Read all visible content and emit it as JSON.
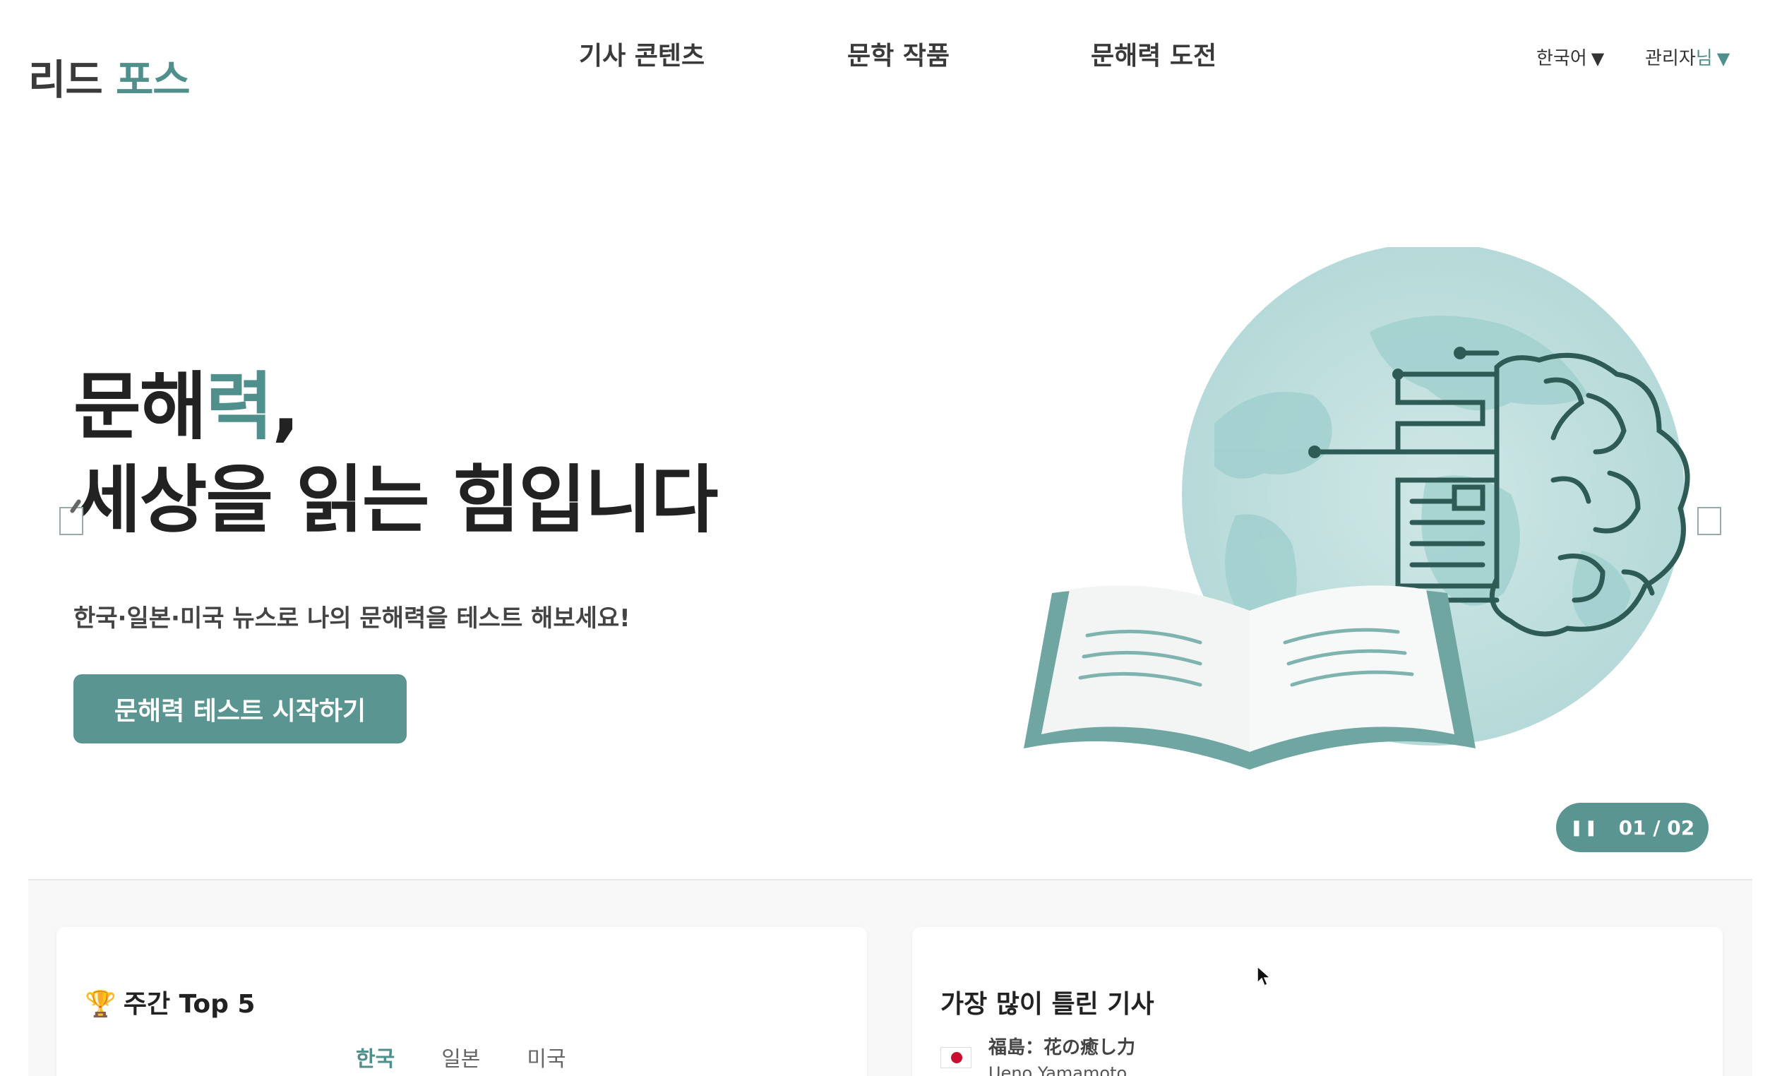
{
  "header": {
    "logo_main": "리드",
    "logo_accent": "포스",
    "nav": [
      "기사 콘텐츠",
      "문학 작품",
      "문해력 도전"
    ],
    "language": "한국어",
    "admin_name": "관리자",
    "admin_suffix": "님"
  },
  "hero": {
    "title_line1_prefix": "문해",
    "title_line1_accent": "력",
    "title_line1_suffix": ",",
    "title_line2": "세상을 읽는 힘입니다",
    "subtitle": "한국·일본·미국 뉴스로 나의 문해력을 테스트 해보세요!",
    "cta_label": "문해력 테스트 시작하기",
    "pager": "01 / 02"
  },
  "weekly_top": {
    "title": "주간 Top 5",
    "tabs": [
      "한국",
      "일본",
      "미국"
    ],
    "active_tab": "한국"
  },
  "most_wrong": {
    "title": "가장 많이 틀린 기사",
    "articles": [
      {
        "title": "福島：花の癒し力",
        "author": "Ueno Yamamoto"
      }
    ]
  },
  "colors": {
    "accent": "#4f8f8c",
    "button": "#5b9592",
    "globe": "#b9dcdb"
  }
}
